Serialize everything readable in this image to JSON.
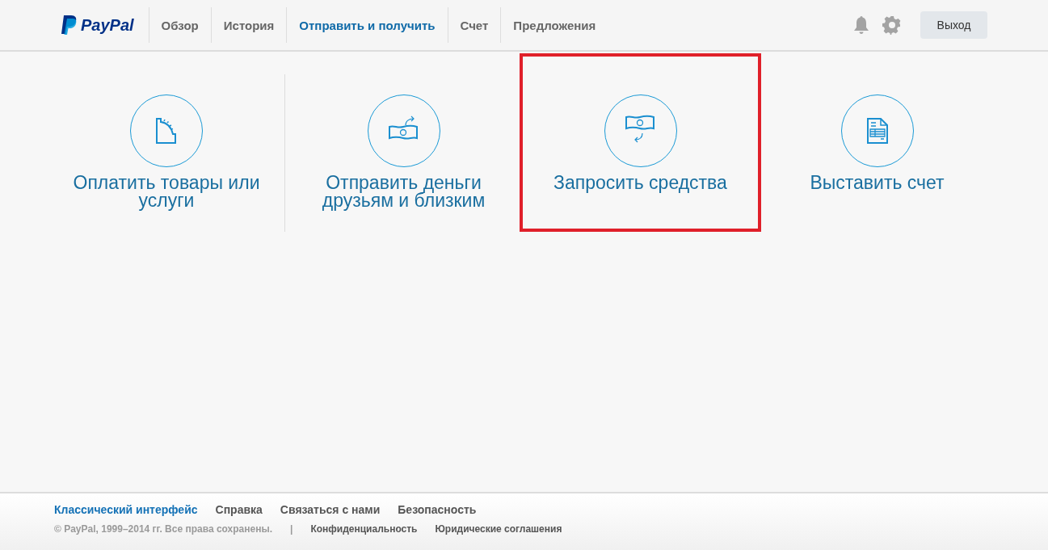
{
  "header": {
    "logo": "PayPal",
    "nav": [
      {
        "label": "Обзор",
        "selected": false
      },
      {
        "label": "История",
        "selected": false
      },
      {
        "label": "Отправить и получить",
        "selected": true
      },
      {
        "label": "Счет",
        "selected": false
      },
      {
        "label": "Предложения",
        "selected": false
      }
    ],
    "logout": "Выход"
  },
  "actions": [
    {
      "kind": "pay",
      "label": "Оплатить товары или услуги",
      "highlighted": false
    },
    {
      "kind": "send",
      "label": "Отправить деньги друзьям и близким",
      "highlighted": false
    },
    {
      "kind": "request",
      "label": "Запросить средства",
      "highlighted": true
    },
    {
      "kind": "invoice",
      "label": "Выставить счет",
      "highlighted": false
    }
  ],
  "footer": {
    "links": [
      {
        "label": "Классический интерфейс",
        "selected": true
      },
      {
        "label": "Справка",
        "selected": false
      },
      {
        "label": "Связаться с нами",
        "selected": false
      },
      {
        "label": "Безопасность",
        "selected": false
      }
    ],
    "copyright": "© PayPal, 1999–2014 гг. Все права сохранены.",
    "separator": "|",
    "legal": [
      "Конфиденциальность",
      "Юридические соглашения"
    ]
  }
}
